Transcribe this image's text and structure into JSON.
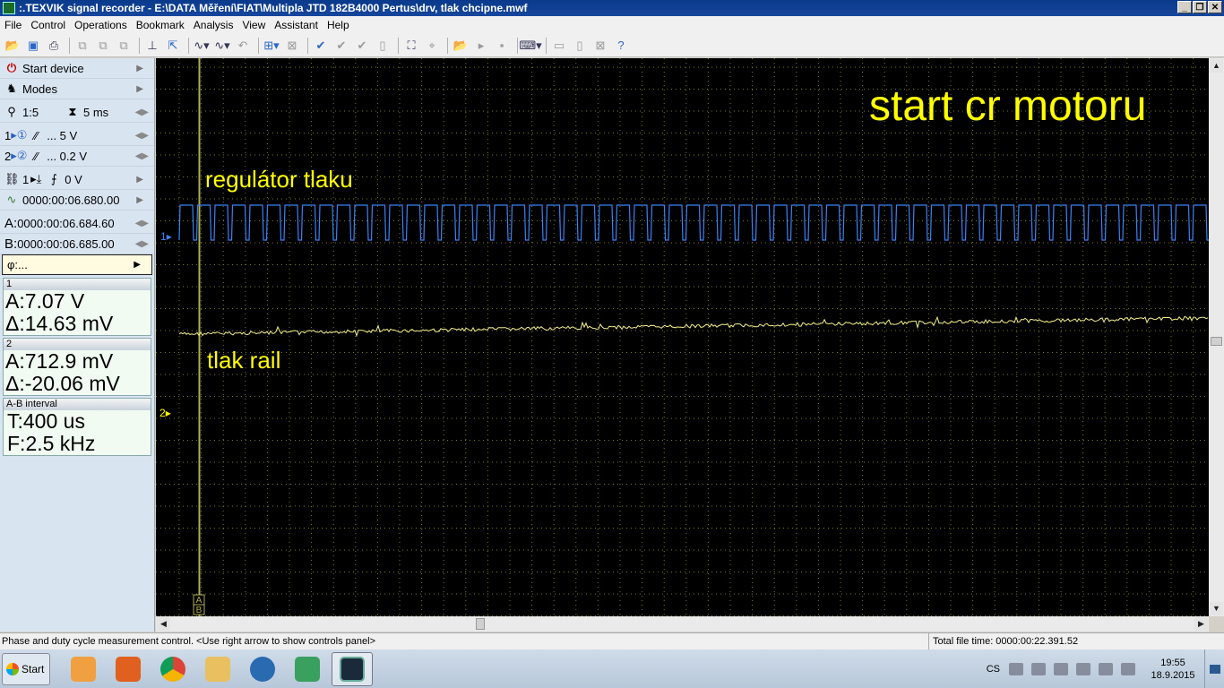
{
  "window": {
    "title": ":.TEXVIK  signal recorder - E:\\DATA Měření\\FIAT\\Multipla JTD 182B4000 Pertus\\drv, tlak chcipne.mwf",
    "buttons": [
      "_",
      "❐",
      "✕"
    ]
  },
  "menu": [
    "File",
    "Control",
    "Operations",
    "Bookmark",
    "Analysis",
    "View",
    "Assistant",
    "Help"
  ],
  "panel": {
    "start_device": "Start device",
    "modes": "Modes",
    "zoom": "1:5",
    "timebase": "5 ms",
    "ch1_num": "1",
    "ch1_range": "... 5 V",
    "ch2_num": "2",
    "ch2_range": "... 0.2 V",
    "trigger_ch": "1",
    "trigger_level": "0 V",
    "trigger_time": "0000:00:06.680.00",
    "cursor_a_label": "A:",
    "cursor_a_time": "0000:00:06.684.60",
    "cursor_b_label": "B:",
    "cursor_b_time": "0000:00:06.685.00",
    "phase": "φ:..."
  },
  "measurements": {
    "ch1": {
      "head": "1",
      "a": "A:7.07 V",
      "delta": "Δ:14.63 mV"
    },
    "ch2": {
      "head": "2",
      "a": "A:712.9 mV",
      "delta": "Δ:-20.06 mV"
    },
    "ab": {
      "head": "A-B interval",
      "t": "T:400 us",
      "f": "F:2.5 kHz"
    }
  },
  "scope": {
    "title": "start cr motoru",
    "label_ch1": "regulátor tlaku",
    "label_ch2": "tlak rail",
    "marker_ch1": "1",
    "marker_ch2": "2",
    "cursor_a": "A",
    "cursor_b": "B",
    "colors": {
      "ch1": "#3b82f6",
      "ch2": "#f3f08a",
      "text": "#ffff00",
      "grid": "#7a7a30",
      "cursor": "#b0b050"
    }
  },
  "status": {
    "hint": "Phase and duty cycle measurement control. <Use right arrow to show controls panel>",
    "total": "Total file time: 0000:00:22.391.52"
  },
  "taskbar": {
    "start": "Start",
    "lang": "CS",
    "time": "19:55",
    "date": "18.9.2015"
  }
}
